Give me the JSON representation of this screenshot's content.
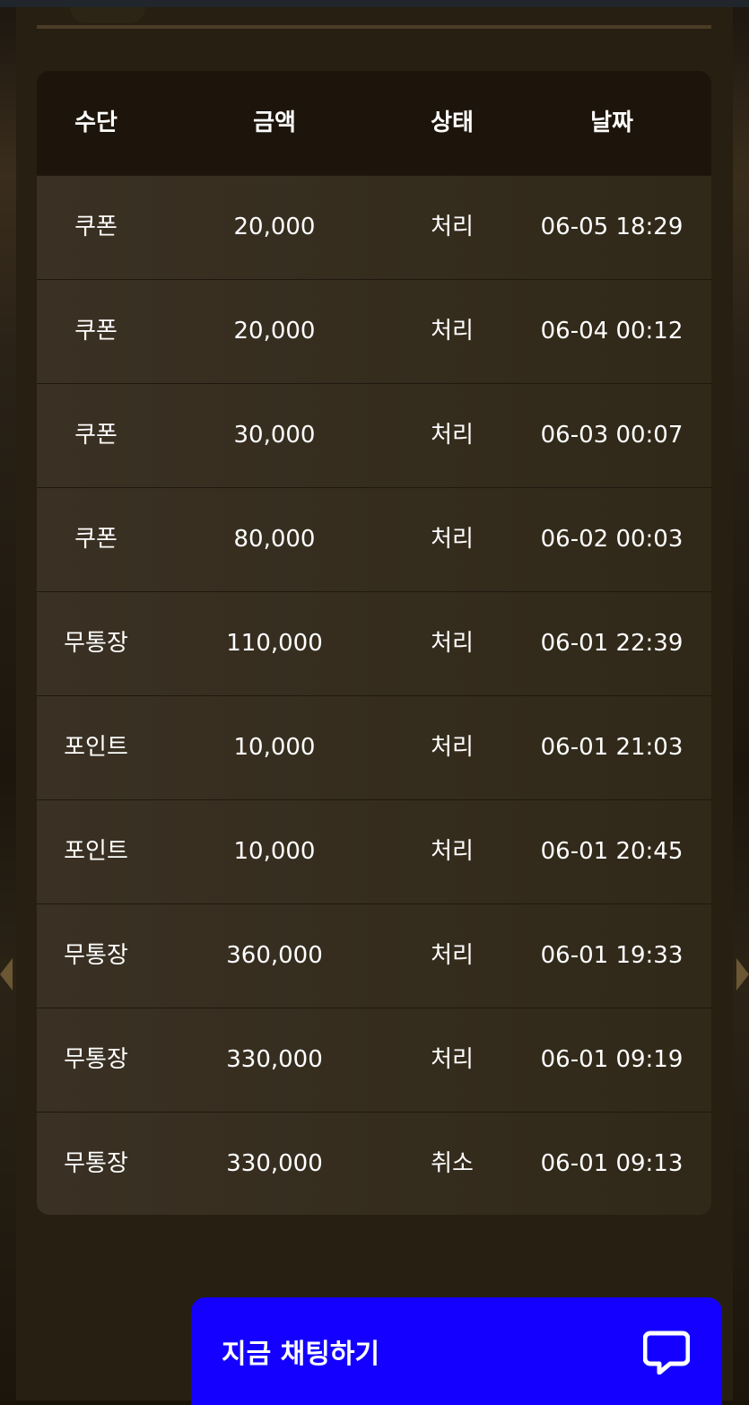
{
  "table": {
    "headers": [
      "수단",
      "금액",
      "상태",
      "날짜"
    ],
    "rows": [
      [
        "쿠폰",
        "20,000",
        "처리",
        "06-05 18:29"
      ],
      [
        "쿠폰",
        "20,000",
        "처리",
        "06-04 00:12"
      ],
      [
        "쿠폰",
        "30,000",
        "처리",
        "06-03 00:07"
      ],
      [
        "쿠폰",
        "80,000",
        "처리",
        "06-02 00:03"
      ],
      [
        "무통장",
        "110,000",
        "처리",
        "06-01 22:39"
      ],
      [
        "포인트",
        "10,000",
        "처리",
        "06-01 21:03"
      ],
      [
        "포인트",
        "10,000",
        "처리",
        "06-01 20:45"
      ],
      [
        "무통장",
        "360,000",
        "처리",
        "06-01 19:33"
      ],
      [
        "무통장",
        "330,000",
        "처리",
        "06-01 09:19"
      ],
      [
        "무통장",
        "330,000",
        "취소",
        "06-01 09:13"
      ]
    ]
  },
  "chat": {
    "label": "지금 채팅하기",
    "icon": "chat-bubble-icon"
  },
  "colors": {
    "panel": "#271f11",
    "header": "#1d150b",
    "row": "#3a3124",
    "chat_button": "#1400ff"
  }
}
